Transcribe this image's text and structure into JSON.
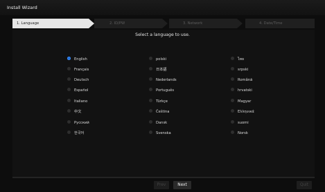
{
  "window": {
    "title": "Install Wizard"
  },
  "steps": [
    {
      "label": "1. Language",
      "active": true
    },
    {
      "label": "2. ID/PW",
      "active": false
    },
    {
      "label": "3. Network",
      "active": false
    },
    {
      "label": "4. Date/Time",
      "active": false
    }
  ],
  "prompt": "Select a language to use.",
  "languages": {
    "col1": [
      "English",
      "Français",
      "Deutsch",
      "Español",
      "Italiano",
      "中文",
      "Русский",
      "한국어"
    ],
    "col2": [
      "polski",
      "日本語",
      "Nederlands",
      "Português",
      "Türkçe",
      "Čeština",
      "Dansk",
      "Svenska"
    ],
    "col3": [
      "ไทย",
      "srpski",
      "Română",
      "hrvatski",
      "Magyar",
      "Ελληνικά",
      "suomi",
      "Norsk"
    ],
    "selected": "English"
  },
  "buttons": {
    "prev": "Prev",
    "next": "Next",
    "quit": "Quit"
  },
  "colors": {
    "accent": "#1d6fe0",
    "active_step": "#e6e6e6"
  }
}
